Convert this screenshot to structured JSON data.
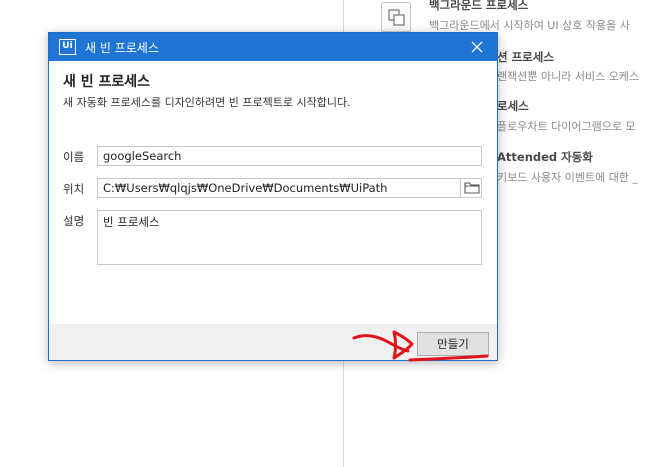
{
  "background_panel": {
    "items": [
      {
        "title": "백그라운드 프로세스",
        "description": "백그라운드에서 시작하여 UI 상호 작용을 사"
      },
      {
        "title": "션 프로세스",
        "description": "랜잭션뿐 아니라 서비스 오케스"
      },
      {
        "title": "로세스",
        "description": "플로우차트 다이어그램으로 모"
      },
      {
        "title": "Attended 자동화",
        "description": "키보드 사용자 이벤트에 대한 _"
      }
    ]
  },
  "dialog": {
    "app_icon_text": "Ui",
    "window_title": "새 빈 프로세스",
    "heading": "새 빈 프로세스",
    "subheading": "새 자동화 프로세스를 디자인하려면 빈 프로젝트로 시작합니다.",
    "fields": {
      "name": {
        "label": "이름",
        "value": "googleSearch"
      },
      "location": {
        "label": "위치",
        "value": "C:₩Users₩qlqjs₩OneDrive₩Documents₩UiPath"
      },
      "description": {
        "label": "설명",
        "value": "빈 프로세스"
      }
    },
    "create_button": "만들기"
  },
  "colors": {
    "titlebar": "#1f74d4",
    "annotation": "#e0141c"
  }
}
